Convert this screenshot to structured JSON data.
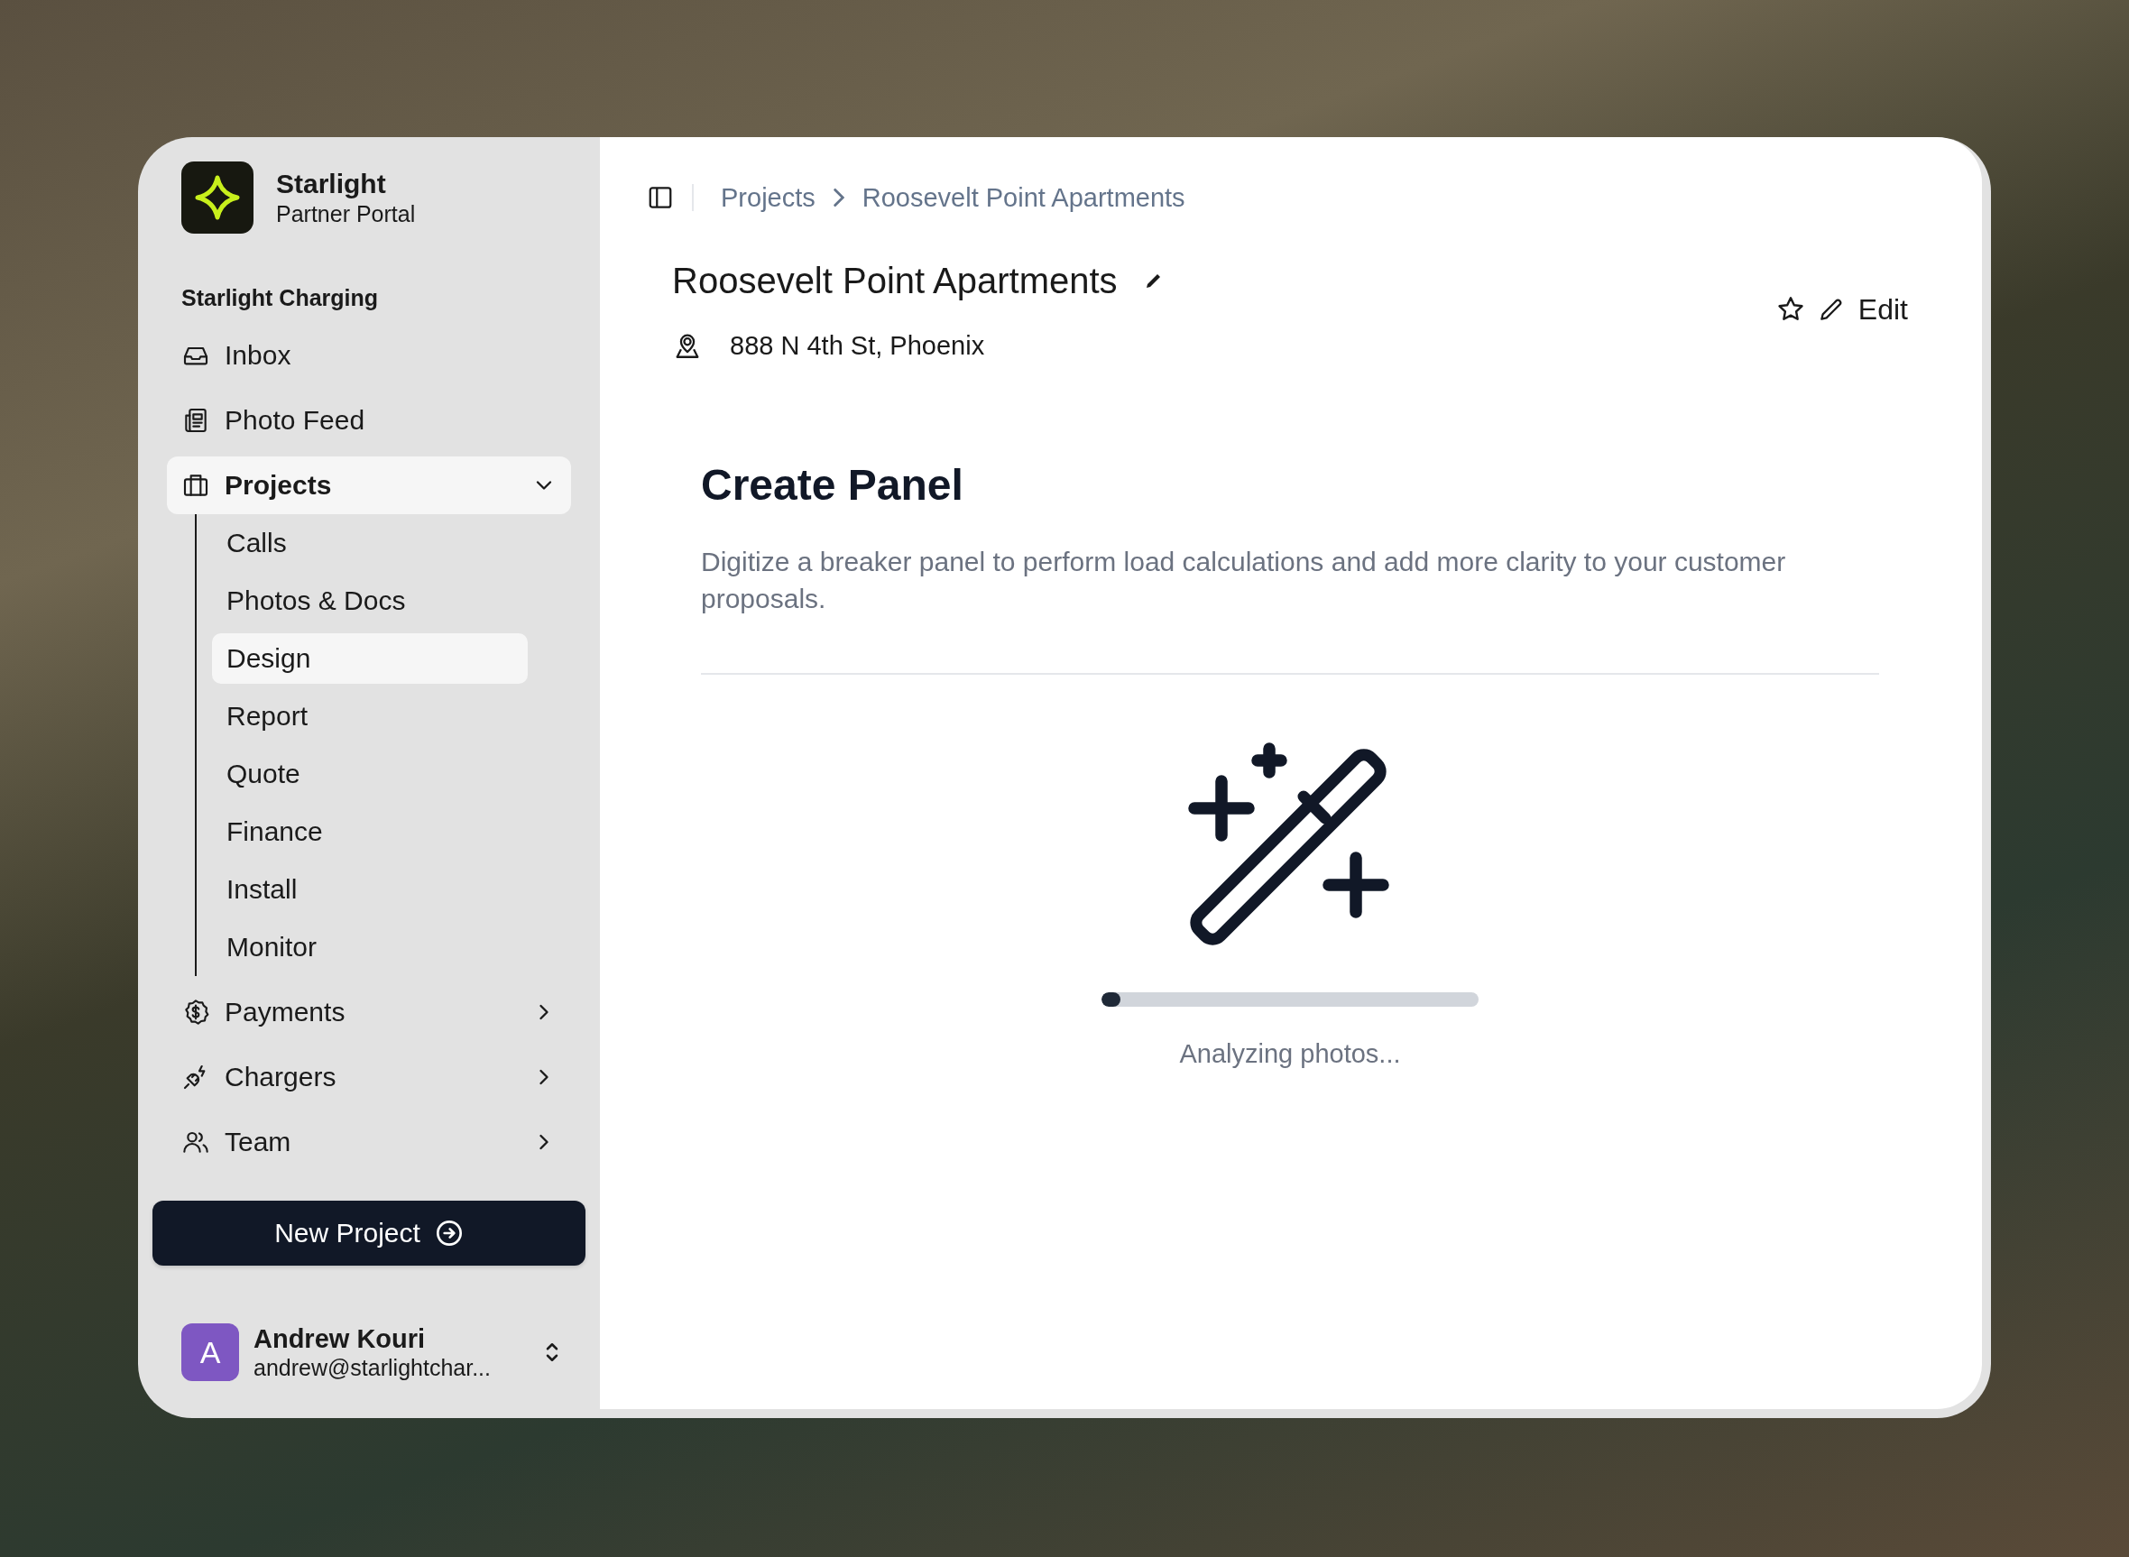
{
  "sidebar": {
    "brand": {
      "name": "Starlight",
      "subtitle": "Partner Portal"
    },
    "org": "Starlight Charging",
    "items": [
      {
        "label": "Inbox",
        "selected": false
      },
      {
        "label": "Photo Feed",
        "selected": false
      },
      {
        "label": "Projects",
        "selected": true,
        "expanded": true,
        "children": [
          {
            "label": "Calls",
            "selected": false
          },
          {
            "label": "Photos & Docs",
            "selected": false
          },
          {
            "label": "Design",
            "selected": true
          },
          {
            "label": "Report",
            "selected": false
          },
          {
            "label": "Quote",
            "selected": false
          },
          {
            "label": "Finance",
            "selected": false
          },
          {
            "label": "Install",
            "selected": false
          },
          {
            "label": "Monitor",
            "selected": false
          }
        ]
      },
      {
        "label": "Payments",
        "selected": false,
        "expanded": false
      },
      {
        "label": "Chargers",
        "selected": false,
        "expanded": false
      },
      {
        "label": "Team",
        "selected": false,
        "expanded": false
      }
    ],
    "new_project_button": "New Project",
    "user": {
      "initial": "A",
      "name": "Andrew Kouri",
      "email": "andrew@starlightchar..."
    }
  },
  "breadcrumb": [
    "Projects",
    "Roosevelt Point Apartments"
  ],
  "project": {
    "title": "Roosevelt Point Apartments",
    "address": "888 N 4th St, Phoenix",
    "edit_button": "Edit"
  },
  "panel": {
    "title": "Create Panel",
    "description": "Digitize a breaker panel to perform load calculations and add more clarity to your customer proposals.",
    "progress": {
      "level": 0.05,
      "label": "Analyzing photos..."
    }
  }
}
